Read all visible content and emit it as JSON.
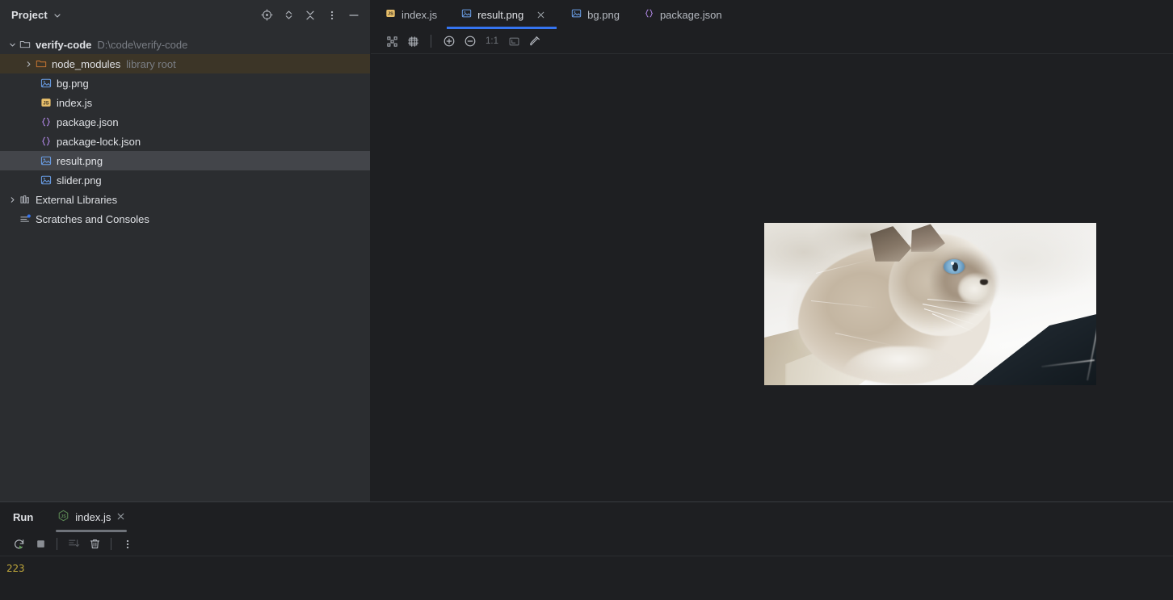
{
  "sidebar": {
    "title": "Project",
    "caret_icon": "chevron-down-icon",
    "actions": [
      {
        "name": "select-opened-file-icon",
        "icon": "target-crosshair-icon"
      },
      {
        "name": "expand-collapse-icon",
        "icon": "chevron-up-down-icon"
      },
      {
        "name": "collapse-all-icon",
        "icon": "collapse-arrows-icon"
      },
      {
        "name": "more-options-icon",
        "icon": "vertical-dots-icon"
      },
      {
        "name": "hide-tool-window-icon",
        "icon": "minimize-dash-icon"
      }
    ],
    "tree": [
      {
        "label": "verify-code",
        "sub": "D:\\code\\verify-code",
        "icon": "folder-icon",
        "indent": 0,
        "arrow": "expanded",
        "bold": true,
        "state": "root"
      },
      {
        "label": "node_modules",
        "sub": "library root",
        "icon": "folder-orange-icon",
        "indent": 1,
        "arrow": "collapsed",
        "state": "library"
      },
      {
        "label": "bg.png",
        "sub": "",
        "icon": "image-file-icon",
        "indent": 2,
        "arrow": "none",
        "state": "normal"
      },
      {
        "label": "index.js",
        "sub": "",
        "icon": "js-file-icon",
        "indent": 2,
        "arrow": "none",
        "state": "normal"
      },
      {
        "label": "package.json",
        "sub": "",
        "icon": "json-file-icon",
        "indent": 2,
        "arrow": "none",
        "state": "normal"
      },
      {
        "label": "package-lock.json",
        "sub": "",
        "icon": "json-file-icon",
        "indent": 2,
        "arrow": "none",
        "state": "normal"
      },
      {
        "label": "result.png",
        "sub": "",
        "icon": "image-file-icon",
        "indent": 2,
        "arrow": "none",
        "state": "selected"
      },
      {
        "label": "slider.png",
        "sub": "",
        "icon": "image-file-icon",
        "indent": 2,
        "arrow": "none",
        "state": "normal"
      },
      {
        "label": "External Libraries",
        "sub": "",
        "icon": "library-icon",
        "indent": 0,
        "arrow": "collapsed",
        "state": "normal"
      },
      {
        "label": "Scratches and Consoles",
        "sub": "",
        "icon": "scratches-icon",
        "indent": 0,
        "arrow": "none",
        "state": "normal"
      }
    ]
  },
  "editor": {
    "tabs": [
      {
        "label": "index.js",
        "icon": "js-file-icon",
        "active": false,
        "closable": false
      },
      {
        "label": "result.png",
        "icon": "image-file-icon",
        "active": true,
        "closable": true
      },
      {
        "label": "bg.png",
        "icon": "image-file-icon",
        "active": false,
        "closable": false
      },
      {
        "label": "package.json",
        "icon": "json-file-icon",
        "active": false,
        "closable": false
      }
    ],
    "toolbar": [
      {
        "name": "toggle-transparency-chessboard-button",
        "icon": "chessboard-icon",
        "label": ""
      },
      {
        "name": "toggle-grid-button",
        "icon": "grid-frame-icon",
        "label": ""
      },
      {
        "name": "separator",
        "icon": "separator",
        "label": ""
      },
      {
        "name": "zoom-in-button",
        "icon": "plus-circle-icon",
        "label": ""
      },
      {
        "name": "zoom-out-button",
        "icon": "minus-circle-icon",
        "label": ""
      },
      {
        "name": "actual-size-button",
        "icon": "text-label",
        "label": "1:1"
      },
      {
        "name": "fit-to-window-button",
        "icon": "fit-screen-icon",
        "label": ""
      },
      {
        "name": "color-picker-button",
        "icon": "eyedropper-icon",
        "label": ""
      }
    ],
    "image": {
      "name": "result.png",
      "alt": "Fluffy cream-colored ragdoll kitten with blue eyes lying on a white blanket next to a dark navy pillow"
    }
  },
  "run_panel": {
    "title": "Run",
    "tab_label": "index.js",
    "tab_icon": "nodejs-hexagon-icon",
    "tab_close_icon": "close-icon",
    "toolbar": [
      {
        "name": "rerun-button",
        "icon": "rerun-icon",
        "enabled": true
      },
      {
        "name": "stop-button",
        "icon": "stop-square-icon",
        "enabled": true
      },
      {
        "name": "separator",
        "icon": "separator",
        "enabled": true
      },
      {
        "name": "scroll-to-end-button",
        "icon": "scroll-to-end-icon",
        "enabled": false
      },
      {
        "name": "clear-all-button",
        "icon": "trash-icon",
        "enabled": true
      },
      {
        "name": "separator",
        "icon": "separator",
        "enabled": true
      },
      {
        "name": "more-options-button",
        "icon": "vertical-dots-icon",
        "enabled": true
      }
    ],
    "output_lines": [
      "223"
    ]
  },
  "colors": {
    "sidebar_bg": "#2b2d30",
    "editor_bg": "#1e1f22",
    "selection_bg": "#43454a",
    "library_row_bg": "#3c3527",
    "accent_blue": "#3574f0",
    "text_primary": "#dfe1e5",
    "text_muted": "#7a7e85",
    "console_output": "#bba33a",
    "js_icon": "#e8bf6a",
    "json_icon": "#b389e8",
    "png_icon": "#6a9fe8",
    "node_green": "#5c8a55"
  }
}
